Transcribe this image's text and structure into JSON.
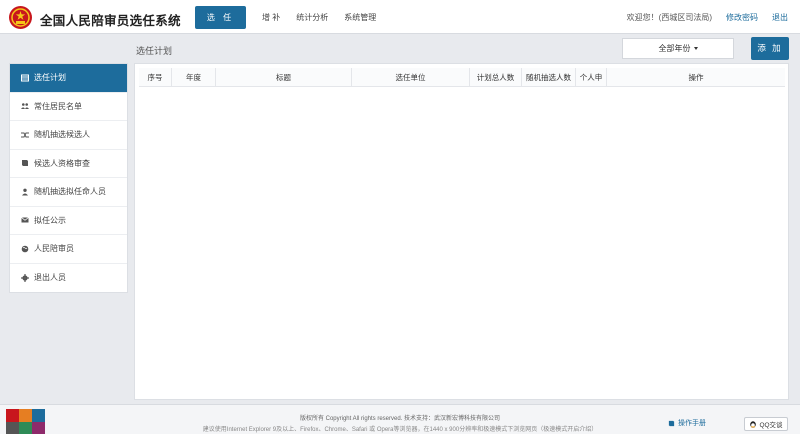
{
  "app": {
    "title": "全国人民陪审员选任系统"
  },
  "nav": {
    "items": [
      {
        "label": "选 任",
        "active": true
      },
      {
        "label": "增 补",
        "active": false
      },
      {
        "label": "统计分析",
        "active": false
      },
      {
        "label": "系统管理",
        "active": false
      }
    ]
  },
  "user": {
    "welcome": "欢迎您！(西城区司法局)",
    "change_password": "修改密码",
    "logout": "退出"
  },
  "section": {
    "title": "选任计划"
  },
  "controls": {
    "year_select": "全部年份",
    "add_button": "添 加"
  },
  "sidebar": {
    "items": [
      {
        "label": "选任计划",
        "icon": "table-icon",
        "active": true
      },
      {
        "label": "常住居民名单",
        "icon": "users-icon",
        "active": false
      },
      {
        "label": "随机抽选候选人",
        "icon": "shuffle-icon",
        "active": false
      },
      {
        "label": "候选人资格审查",
        "icon": "book-icon",
        "active": false
      },
      {
        "label": "随机抽选拟任命人员",
        "icon": "user-icon",
        "active": false
      },
      {
        "label": "拟任公示",
        "icon": "envelope-icon",
        "active": false
      },
      {
        "label": "人民陪审员",
        "icon": "globe-icon",
        "active": false
      },
      {
        "label": "退出人员",
        "icon": "gear-icon",
        "active": false
      }
    ]
  },
  "table": {
    "columns": [
      "序号",
      "年度",
      "标题",
      "选任单位",
      "计划总人数",
      "随机抽选人数",
      "个人申",
      "操作"
    ],
    "rows": []
  },
  "footer": {
    "copyright": "版权所有 Copyright All rights reserved. 技术支持：武汉新宏博科技有限公司",
    "browser_tip": "建议使用Internet Explorer 9及以上、Firefox、Chrome、Safari 或 Opera等浏览器，在1440 x 900分辨率和极速模式下浏览网页（极速模式开启介绍）",
    "manual": "操作手册",
    "qq": "QQ交谈"
  },
  "colors": {
    "primary": "#1d6c9c",
    "background": "#e8eaee"
  }
}
